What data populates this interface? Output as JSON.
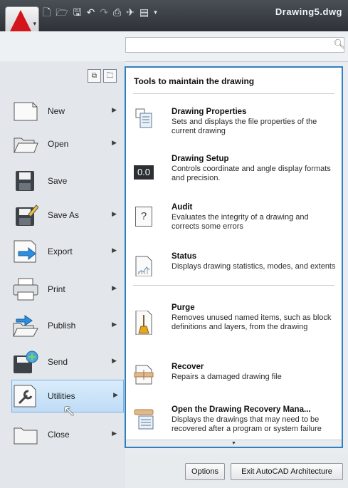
{
  "titlebar": {
    "document_title": "Drawing5.dwg",
    "app_button_letter": "A",
    "qat_icons": [
      "new-icon",
      "open-icon",
      "save-icon",
      "undo-icon",
      "redo-icon",
      "plot-icon",
      "publish-icon",
      "properties-icon",
      "dropdown-icon"
    ]
  },
  "search": {
    "placeholder": "",
    "value": ""
  },
  "menu": {
    "items": [
      {
        "label": "New",
        "has_submenu": true
      },
      {
        "label": "Open",
        "has_submenu": true
      },
      {
        "label": "Save",
        "has_submenu": false
      },
      {
        "label": "Save As",
        "has_submenu": true
      },
      {
        "label": "Export",
        "has_submenu": true
      },
      {
        "label": "Print",
        "has_submenu": true
      },
      {
        "label": "Publish",
        "has_submenu": true
      },
      {
        "label": "Send",
        "has_submenu": true
      },
      {
        "label": "Utilities",
        "has_submenu": true
      },
      {
        "label": "Close",
        "has_submenu": true
      }
    ],
    "active_item": "Utilities"
  },
  "panel": {
    "title": "Tools to maintain the drawing",
    "items": [
      {
        "name": "Drawing Properties",
        "desc": "Sets and displays the file properties of the current drawing",
        "icon": "drawing-properties-icon"
      },
      {
        "name": "Drawing Setup",
        "desc": "Controls coordinate and angle display formats and precision.",
        "icon": "drawing-setup-icon",
        "icon_text": "0.0"
      },
      {
        "name": "Audit",
        "desc": "Evaluates the integrity of a drawing and corrects some errors",
        "icon": "audit-icon",
        "icon_text": "?"
      },
      {
        "name": "Status",
        "desc": "Displays drawing statistics, modes, and extents",
        "icon": "status-icon"
      },
      {
        "name": "Purge",
        "desc": "Removes unused named items, such as block definitions and layers, from the drawing",
        "icon": "purge-icon"
      },
      {
        "name": "Recover",
        "desc": "Repairs a damaged drawing file",
        "icon": "recover-icon"
      },
      {
        "name": "Open the Drawing Recovery Mana...",
        "desc": "Displays the drawings that may need to be recovered after a program or system failure",
        "icon": "drawing-recovery-icon"
      }
    ]
  },
  "buttons": {
    "options": "Options",
    "exit": "Exit AutoCAD Architecture"
  },
  "colors": {
    "accent_border": "#2f7fc2",
    "active_bg": "#cfe6fa",
    "titlebar": "#3b4046"
  }
}
